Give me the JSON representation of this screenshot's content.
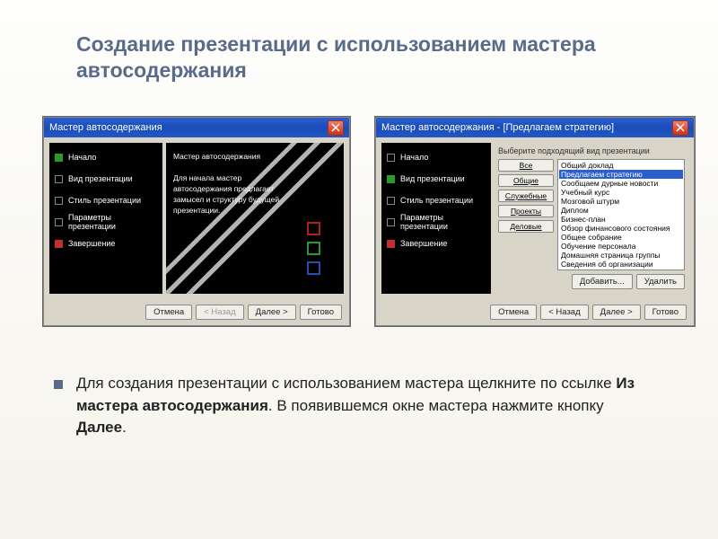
{
  "slide": {
    "title": "Создание презентации с использованием мастера автосодержания",
    "body_part1": "Для создания презентации с использованием мастера щелкните по ссылке ",
    "body_bold1": "Из мастера автосодержания",
    "body_part2": ". В появившемся окне мастера нажмите кнопку ",
    "body_bold2": "Далее",
    "body_part3": "."
  },
  "win1": {
    "title": "Мастер автосодержания",
    "content_title": "Мастер автосодержания",
    "content_text": "Для начала мастер автосодержания предлагает замысел и структуру будущей презентации.",
    "steps": [
      {
        "label": "Начало",
        "color": "green"
      },
      {
        "label": "Вид презентации",
        "color": "outline"
      },
      {
        "label": "Стиль презентации",
        "color": "outline"
      },
      {
        "label": "Параметры презентации",
        "color": "outline"
      },
      {
        "label": "Завершение",
        "color": "red"
      }
    ],
    "buttons": {
      "cancel": "Отмена",
      "back": "< Назад",
      "next": "Далее >",
      "finish": "Готово"
    }
  },
  "win2": {
    "title": "Мастер автосодержания - [Предлагаем стратегию]",
    "prompt": "Выберите подходящий вид презентации",
    "steps": [
      {
        "label": "Начало",
        "color": "outline"
      },
      {
        "label": "Вид презентации",
        "color": "green"
      },
      {
        "label": "Стиль презентации",
        "color": "outline"
      },
      {
        "label": "Параметры презентации",
        "color": "outline"
      },
      {
        "label": "Завершение",
        "color": "red"
      }
    ],
    "filters": [
      "Все",
      "Общие",
      "Служебные",
      "Проекты",
      "Деловые"
    ],
    "list": [
      "Общий доклад",
      "Предлагаем стратегию",
      "Сообщаем дурные новости",
      "Учебный курс",
      "Мозговой штурм",
      "Диплом",
      "Бизнес-план",
      "Обзор финансового состояния",
      "Общее собрание",
      "Обучение персонала",
      "Домашняя страница группы",
      "Сведения об организации"
    ],
    "selected_index": 1,
    "add": "Добавить...",
    "remove": "Удалить",
    "buttons": {
      "cancel": "Отмена",
      "back": "< Назад",
      "next": "Далее >",
      "finish": "Готово"
    }
  }
}
